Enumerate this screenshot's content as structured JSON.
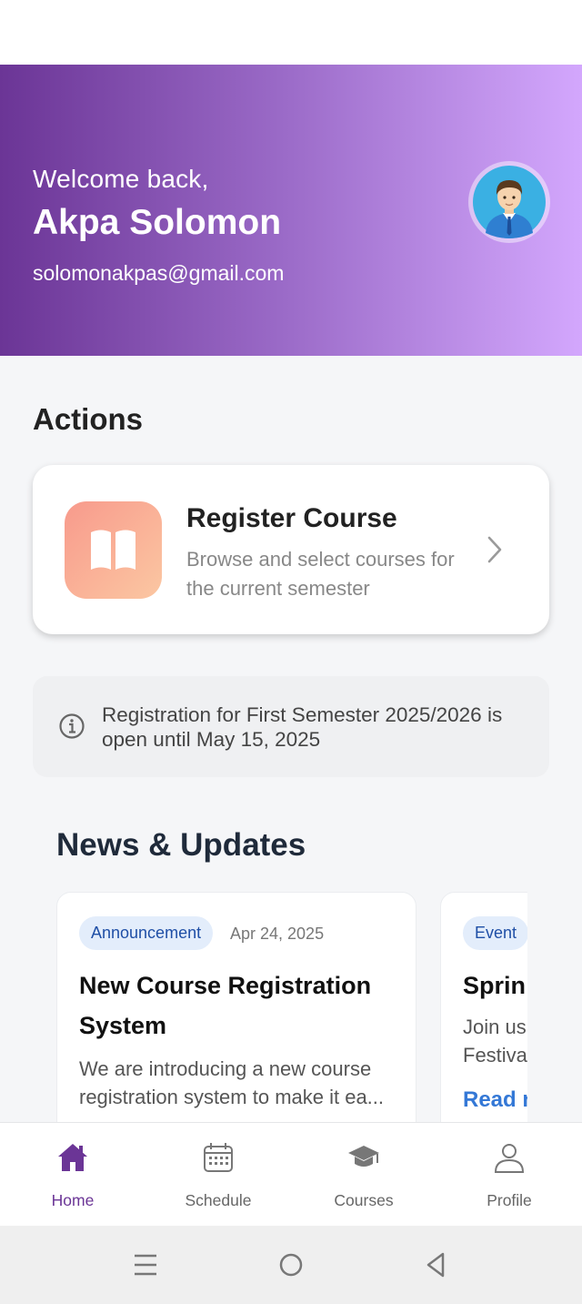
{
  "header": {
    "greeting": "Welcome back,",
    "name": "Akpa Solomon",
    "email": "solomonakpas@gmail.com",
    "avatar_icon": "user-avatar-icon"
  },
  "actions": {
    "title": "Actions",
    "register": {
      "title": "Register Course",
      "description": "Browse and select courses for the current semester",
      "icon": "open-book-icon"
    }
  },
  "notice": {
    "icon": "info-icon",
    "text": "Registration for First Semester 2025/2026 is open until May 15, 2025"
  },
  "news": {
    "title": "News & Updates",
    "items": [
      {
        "badge": "Announcement",
        "date": "Apr 24, 2025",
        "headline": "New Course Registration System",
        "excerpt": "We are introducing a new course registration system to make it ea..."
      },
      {
        "badge": "Event",
        "headline": "Sprin",
        "excerpt": "Join us\nFestiva",
        "link": "Read r"
      }
    ]
  },
  "nav": {
    "items": [
      {
        "label": "Home",
        "icon": "home-icon",
        "active": true
      },
      {
        "label": "Schedule",
        "icon": "calendar-icon"
      },
      {
        "label": "Courses",
        "icon": "graduation-cap-icon"
      },
      {
        "label": "Profile",
        "icon": "person-icon"
      }
    ]
  },
  "colors": {
    "header_start": "#6b3596",
    "header_end": "#d3a7fd",
    "active_nav": "#6b3596",
    "link": "#3478d6"
  }
}
